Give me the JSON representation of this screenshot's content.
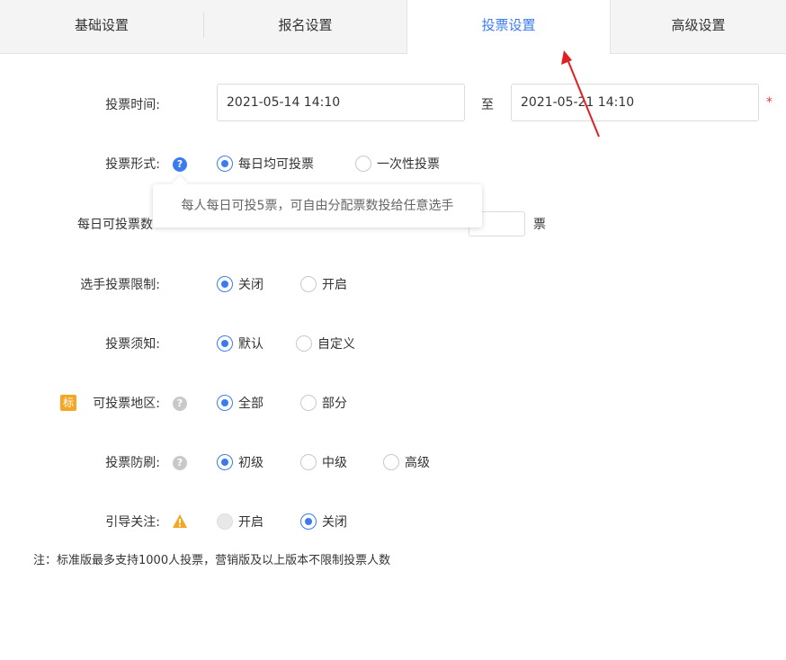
{
  "tabs": [
    {
      "label": "基础设置"
    },
    {
      "label": "报名设置"
    },
    {
      "label": "投票设置"
    },
    {
      "label": "高级设置"
    }
  ],
  "vote_time": {
    "label": "投票时间:",
    "start": "2021-05-14 14:10",
    "to": "至",
    "end": "2021-05-21 14:10",
    "required": "*"
  },
  "vote_form": {
    "label": "投票形式:",
    "options": [
      "每日均可投票",
      "一次性投票"
    ],
    "tooltip": "每人每日可投5票，可自由分配票数投给任意选手"
  },
  "daily_votes": {
    "label": "每日可投票数",
    "unit": "票"
  },
  "contestant_limit": {
    "label": "选手投票限制:",
    "options": [
      "关闭",
      "开启"
    ]
  },
  "vote_notice": {
    "label": "投票须知:",
    "options": [
      "默认",
      "自定义"
    ]
  },
  "region": {
    "badge": "标",
    "label": "可投票地区:",
    "options": [
      "全部",
      "部分"
    ]
  },
  "anti_fraud": {
    "label": "投票防刷:",
    "options": [
      "初级",
      "中级",
      "高级"
    ]
  },
  "guide_follow": {
    "label": "引导关注:",
    "options": [
      "开启",
      "关闭"
    ]
  },
  "note": "注：标准版最多支持1000人投票，营销版及以上版本不限制投票人数",
  "colors": {
    "accent": "#3a7bf0",
    "arrow": "#e02020",
    "badge": "#f5a623"
  }
}
